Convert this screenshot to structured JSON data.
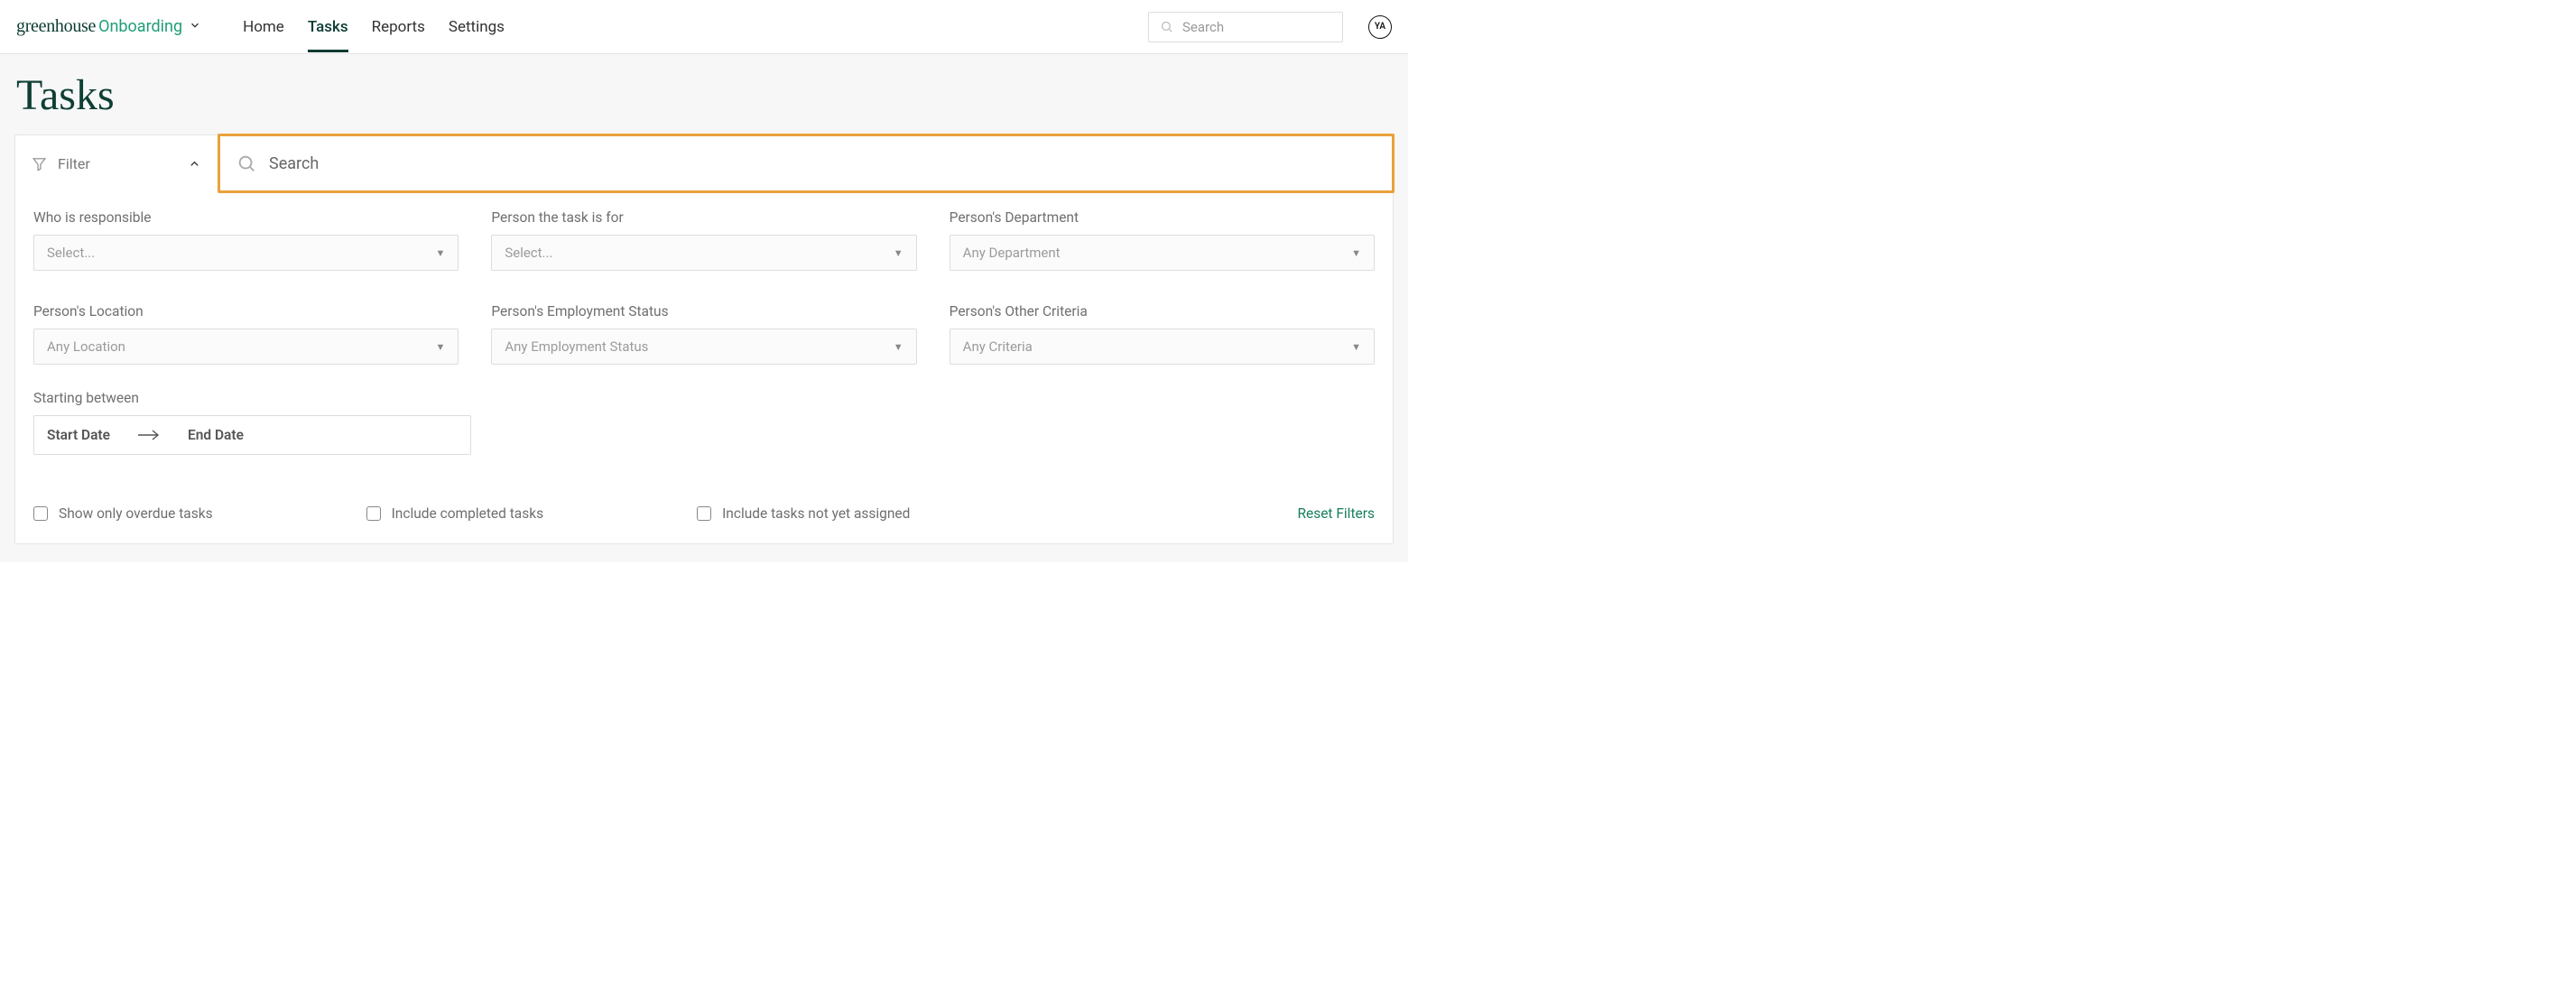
{
  "header": {
    "logo_main": "greenhouse",
    "logo_sub": "Onboarding",
    "nav": {
      "home": "Home",
      "tasks": "Tasks",
      "reports": "Reports",
      "settings": "Settings"
    },
    "search_placeholder": "Search",
    "avatar_initials": "YA"
  },
  "page": {
    "title": "Tasks"
  },
  "filter_bar": {
    "label": "Filter",
    "search_placeholder": "Search"
  },
  "filters": {
    "responsible": {
      "label": "Who is responsible",
      "placeholder": "Select..."
    },
    "task_for": {
      "label": "Person the task is for",
      "placeholder": "Select..."
    },
    "department": {
      "label": "Person's Department",
      "placeholder": "Any Department"
    },
    "location": {
      "label": "Person's Location",
      "placeholder": "Any Location"
    },
    "employment": {
      "label": "Person's Employment Status",
      "placeholder": "Any Employment Status"
    },
    "other": {
      "label": "Person's Other Criteria",
      "placeholder": "Any Criteria"
    },
    "starting": {
      "label": "Starting between",
      "start": "Start Date",
      "end": "End Date"
    }
  },
  "checks": {
    "overdue": "Show only overdue tasks",
    "completed": "Include completed tasks",
    "unassigned": "Include tasks not yet assigned"
  },
  "actions": {
    "reset": "Reset Filters"
  }
}
